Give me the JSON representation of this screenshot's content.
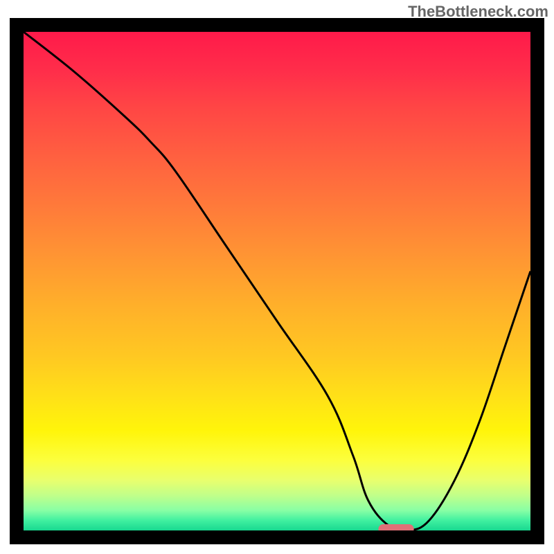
{
  "watermark": "TheBottleneck.com",
  "chart_data": {
    "type": "line",
    "title": "",
    "xlabel": "",
    "ylabel": "",
    "xlim": [
      0,
      100
    ],
    "ylim": [
      0,
      100
    ],
    "x": [
      0,
      10,
      20,
      25,
      30,
      40,
      50,
      60,
      65,
      68,
      72,
      76,
      80,
      85,
      90,
      95,
      100
    ],
    "values": [
      100,
      92,
      83,
      78,
      72,
      57,
      42,
      27,
      15,
      6,
      1,
      0,
      2,
      10,
      22,
      37,
      52
    ],
    "marker": {
      "x_start": 70,
      "x_end": 77,
      "y": 0
    },
    "gradient_colors": {
      "top": "#ff1a4a",
      "mid_upper": "#ff9533",
      "mid": "#ffe018",
      "mid_lower": "#fcff3e",
      "bottom": "#18d890"
    }
  }
}
